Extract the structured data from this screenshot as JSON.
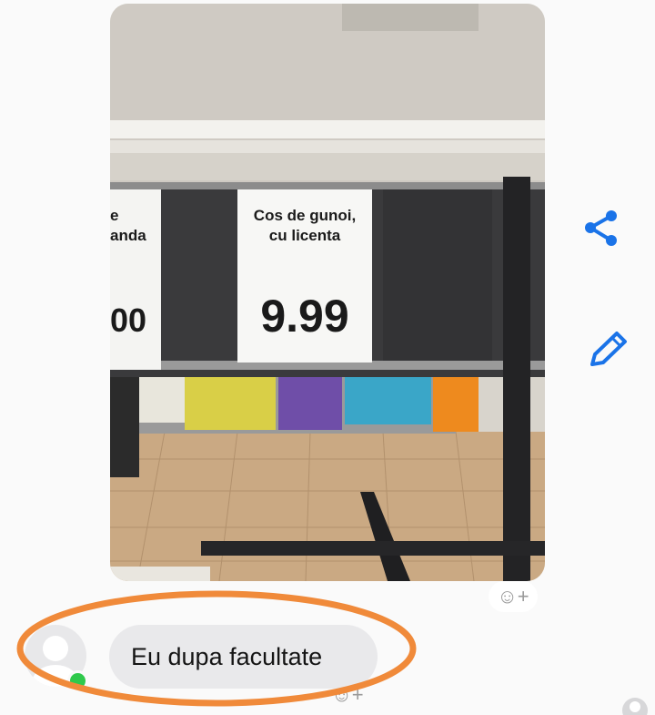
{
  "message_photo": {
    "sign_left_partial": [
      "e",
      "anda"
    ],
    "sign_left_price_partial": "00",
    "sign_title_line1": "Cos de gunoi,",
    "sign_title_line2": "cu licenta",
    "sign_price": "9.99"
  },
  "side_actions": {
    "share_icon": "share-icon",
    "edit_icon": "pencil-icon"
  },
  "reaction_button": {
    "label": "☺+"
  },
  "reply": {
    "text": "Eu dupa facultate",
    "reaction_label": "☺+"
  },
  "colors": {
    "accent": "#1a73e8",
    "annotation": "#f08a3a",
    "presence": "#2fc94c",
    "bubble": "#e9e9eb"
  }
}
